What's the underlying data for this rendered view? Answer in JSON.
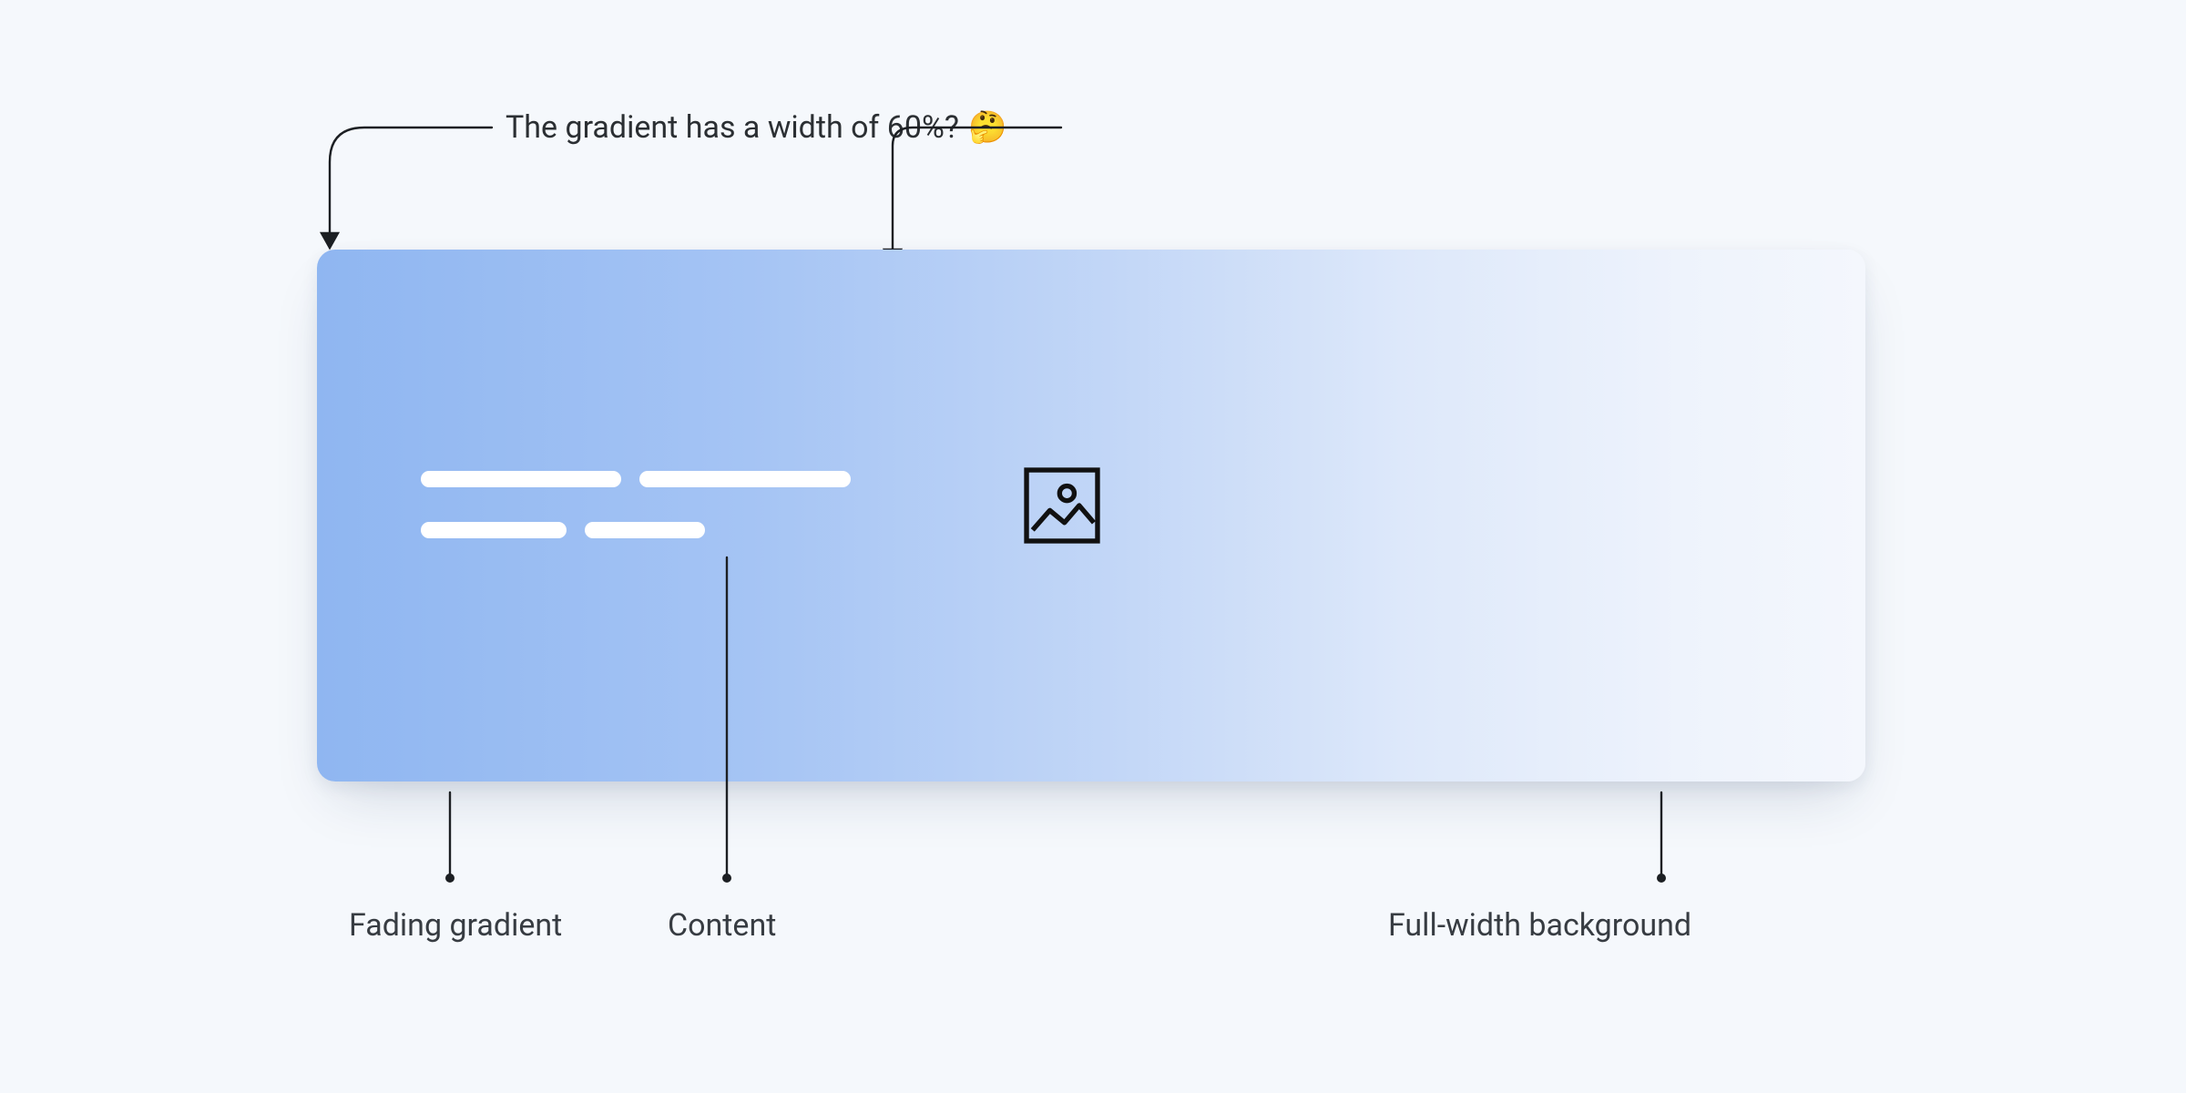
{
  "annotations": {
    "top": {
      "text": "The gradient has a width of 60%?",
      "emoji": "🤔"
    },
    "fading_gradient": "Fading gradient",
    "content": "Content",
    "full_width_bg": "Full-width background"
  },
  "card": {
    "gradient_from": "#8fb6f1",
    "gradient_to": "#f4f7fd",
    "width_pct_label": "60%"
  },
  "content_placeholder": {
    "rows": [
      {
        "bars": [
          220,
          232
        ]
      },
      {
        "bars": [
          160,
          132
        ]
      }
    ]
  },
  "icon": {
    "name": "image-placeholder-icon"
  }
}
